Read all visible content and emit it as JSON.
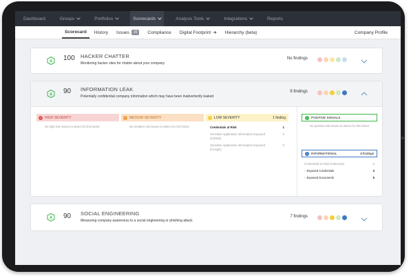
{
  "nav": {
    "items": [
      {
        "label": "Dashboard",
        "dropdown": false
      },
      {
        "label": "Groups",
        "dropdown": true
      },
      {
        "label": "Portfolios",
        "dropdown": true
      },
      {
        "label": "Scorecards",
        "dropdown": true,
        "active": true
      },
      {
        "label": "Analysis Tools",
        "dropdown": true
      },
      {
        "label": "Integrations",
        "dropdown": true
      },
      {
        "label": "Reports",
        "dropdown": false
      }
    ]
  },
  "subnav": {
    "scorecard": "Scorecard",
    "history": "History",
    "issues": "Issues",
    "issues_count": "20",
    "compliance": "Compliance",
    "digital_footprint": "Digital Footprint",
    "hierarchy": "Hierarchy (beta)",
    "company_profile": "Company Profile"
  },
  "cards": {
    "hacker": {
      "grade": "A",
      "score": "100",
      "title": "HACKER CHATTER",
      "desc": "Monitoring hacker sites for chatter about your company",
      "findings": "No findings"
    },
    "leak": {
      "grade": "A",
      "score": "90",
      "title": "INFORMATION LEAK",
      "desc": "Potentially confidential company information which may have been inadvertently leaked",
      "findings": "9 findings",
      "high": {
        "label": "HIGH SEVERITY",
        "note": "No high risk issues to detect for this factor"
      },
      "medium": {
        "label": "MEDIUM SEVERITY",
        "note": "No medium risk issues to detect for this factor"
      },
      "low": {
        "label": "LOW SEVERITY",
        "count": "1 finding",
        "rows": [
          {
            "label": "Credentials at Risk",
            "value": "1"
          },
          {
            "label": "Sensitive Application Information Exposed (GitHub)",
            "value": "0"
          },
          {
            "label": "Sensitive Application Information Exposed (Google)",
            "value": "0"
          }
        ]
      },
      "positive": {
        "label": "POSITIVE SIGNALS",
        "note": "No positive risk issues to detect for this factor"
      },
      "informational": {
        "label": "INFORMATIONAL",
        "count": "8 findings",
        "rows": [
          {
            "label": "Credentials at Risk (Historical)",
            "value": "0"
          },
          {
            "label": "Exposed Credentials",
            "value": "3"
          },
          {
            "label": "Exposed Documents",
            "value": "5"
          }
        ]
      }
    },
    "social": {
      "grade": "A",
      "score": "90",
      "title": "SOCIAL ENGINEERING",
      "desc": "Measuring company awareness to a social engineering or phishing attack",
      "findings": "7 findings"
    }
  },
  "colors": {
    "grade_green": "#3bb54a",
    "high": "#f7d5d5",
    "high_icon": "#e0524f",
    "medium": "#fbe0c4",
    "medium_icon": "#ef9a43",
    "low": "#fdf2c6",
    "low_icon": "#f3cf3d",
    "positive": "#3bb54a",
    "info": "#3f78c3",
    "dot_red": "#f5c2c2",
    "dot_orange": "#f9d6b6",
    "dot_yellow": "#f6e7a4",
    "dot_green": "#cde9c8",
    "dot_blue": "#c9dcf1"
  }
}
